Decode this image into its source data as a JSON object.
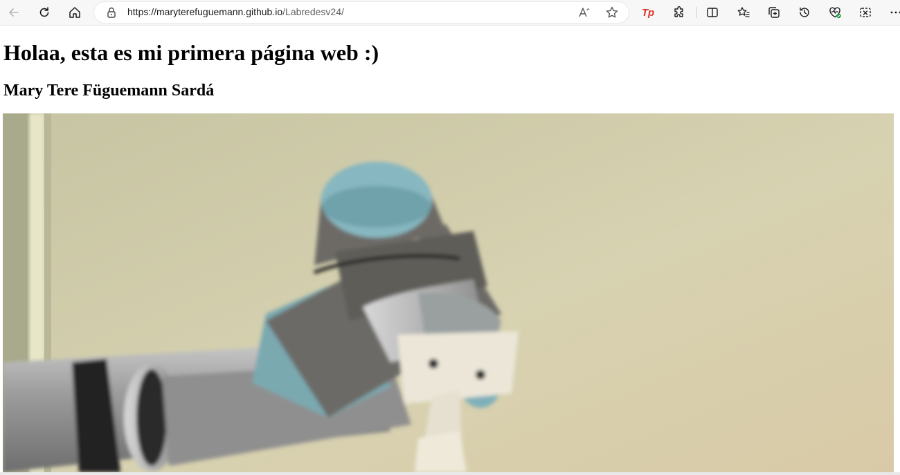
{
  "browser": {
    "url_host": "https://maryterefuguemann.github.io",
    "url_path": "/Labredesv24/",
    "extension_label": "Tp"
  },
  "page": {
    "heading": "Holaa, esta es mi primera página web :)",
    "subheading": "Mary Tere Füguemann Sardá"
  },
  "image": {
    "subject": "robot-arm"
  }
}
